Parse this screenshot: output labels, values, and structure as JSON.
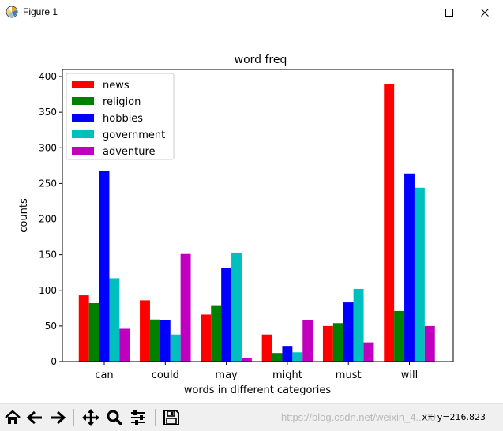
{
  "window": {
    "title": "Figure 1",
    "minimize_icon": "minimize-icon",
    "maximize_icon": "maximize-icon",
    "close_icon": "close-icon"
  },
  "toolbar": {
    "tools": [
      "home-icon",
      "back-arrow-icon",
      "forward-arrow-icon",
      "pan-icon",
      "zoom-icon",
      "configure-subplots-icon",
      "save-icon"
    ],
    "coords": "x= y=216.823",
    "watermark": "https://blog.csdn.net/weixin_4...00"
  },
  "chart_data": {
    "type": "bar",
    "title": "word freq",
    "xlabel": "words in different categories",
    "ylabel": "counts",
    "categories": [
      "can",
      "could",
      "may",
      "might",
      "must",
      "will"
    ],
    "ylim": [
      0,
      410
    ],
    "yticks": [
      0,
      50,
      100,
      150,
      200,
      250,
      300,
      350,
      400
    ],
    "legend_position": "top-left",
    "grid": false,
    "series": [
      {
        "name": "news",
        "color": "#ff0000",
        "values": [
          93,
          86,
          66,
          38,
          50,
          389
        ]
      },
      {
        "name": "religion",
        "color": "#008000",
        "values": [
          82,
          59,
          78,
          12,
          54,
          71
        ]
      },
      {
        "name": "hobbies",
        "color": "#0000ff",
        "values": [
          268,
          58,
          131,
          22,
          83,
          264
        ]
      },
      {
        "name": "government",
        "color": "#00bfbf",
        "values": [
          117,
          38,
          153,
          13,
          102,
          244
        ]
      },
      {
        "name": "adventure",
        "color": "#bf00bf",
        "values": [
          46,
          151,
          5,
          58,
          27,
          50
        ]
      }
    ]
  }
}
